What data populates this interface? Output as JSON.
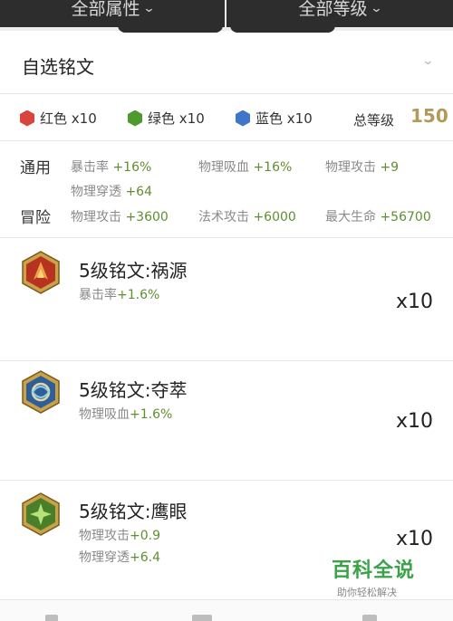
{
  "filters": {
    "attribute_label": "全部属性",
    "level_label": "全部等级"
  },
  "header": {
    "title": "自选铭文"
  },
  "colors": {
    "red": {
      "label": "红色 x10",
      "color": "#d9453b"
    },
    "green": {
      "label": "绿色 x10",
      "color": "#4f9a2f"
    },
    "blue": {
      "label": "蓝色 x10",
      "color": "#3f76c8"
    },
    "total_label": "总等级",
    "total_value": "150"
  },
  "stats": {
    "general_label": "通用",
    "adventure_label": "冒险",
    "general": [
      {
        "name": "暴击率",
        "value": "+16%"
      },
      {
        "name": "物理吸血",
        "value": "+16%"
      },
      {
        "name": "物理攻击",
        "value": "+9"
      },
      {
        "name": "物理穿透",
        "value": "+64"
      }
    ],
    "adventure": [
      {
        "name": "物理攻击",
        "value": "+3600"
      },
      {
        "name": "法术攻击",
        "value": "+6000"
      },
      {
        "name": "最大生命",
        "value": "+56700"
      }
    ]
  },
  "runes": [
    {
      "name": "5级铭文:祸源",
      "effects": [
        {
          "name": "暴击率",
          "value": "+1.6%"
        }
      ],
      "count": "x10",
      "icon": "red-rune-icon"
    },
    {
      "name": "5级铭文:夺萃",
      "effects": [
        {
          "name": "物理吸血",
          "value": "+1.6%"
        }
      ],
      "count": "x10",
      "icon": "blue-rune-icon"
    },
    {
      "name": "5级铭文:鹰眼",
      "effects": [
        {
          "name": "物理攻击",
          "value": "+0.9"
        },
        {
          "name": "物理穿透",
          "value": "+6.4"
        }
      ],
      "count": "x10",
      "icon": "green-rune-icon"
    }
  ],
  "watermark": {
    "main": "百科全说",
    "sub": "助你轻松解决"
  }
}
